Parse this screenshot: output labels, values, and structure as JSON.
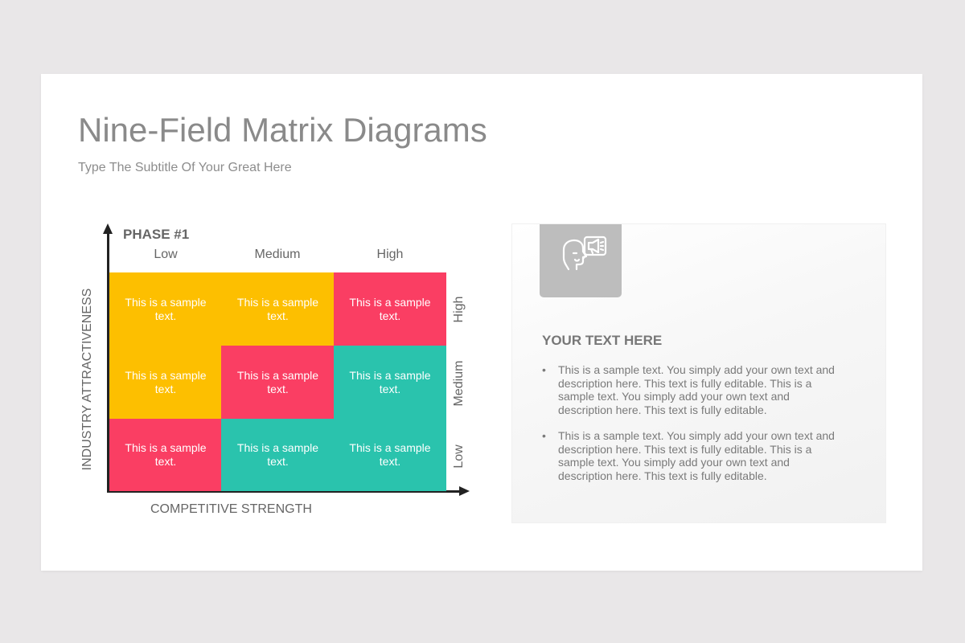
{
  "slide": {
    "title": "Nine-Field Matrix Diagrams",
    "subtitle": "Type The Subtitle Of Your Great Here"
  },
  "matrix": {
    "phase": "PHASE #1",
    "x_axis_title": "COMPETITIVE STRENGTH",
    "y_axis_title": "INDUSTRY ATTRACTIVENESS",
    "columns": [
      "Low",
      "Medium",
      "High"
    ],
    "rows": [
      "High",
      "Medium",
      "Low"
    ],
    "colors": {
      "yellow": "#fdbf00",
      "red": "#fa3e63",
      "teal": "#2ac3ad"
    },
    "cells": [
      {
        "text": "This is a sample text.",
        "color": "#fdbf00"
      },
      {
        "text": "This is a sample text.",
        "color": "#fdbf00"
      },
      {
        "text": "This is a sample text.",
        "color": "#fa3e63"
      },
      {
        "text": "This is a sample text.",
        "color": "#fdbf00"
      },
      {
        "text": "This is a sample text.",
        "color": "#fa3e63"
      },
      {
        "text": "This is a sample text.",
        "color": "#2ac3ad"
      },
      {
        "text": "This is a sample text.",
        "color": "#fa3e63"
      },
      {
        "text": "This is a sample text.",
        "color": "#2ac3ad"
      },
      {
        "text": "This is a sample text.",
        "color": "#2ac3ad"
      }
    ]
  },
  "panel": {
    "icon": "head-megaphone-icon",
    "heading": "YOUR TEXT HERE",
    "bullets": [
      "This is a sample text. You simply add your own text and description here. This text is fully editable. This is a sample text. You simply add your own text and description here. This text is fully editable.",
      "This is a sample text. You simply add your own text and description here. This text is fully editable. This is a sample text. You simply add your own text and description here. This text is fully editable."
    ]
  }
}
